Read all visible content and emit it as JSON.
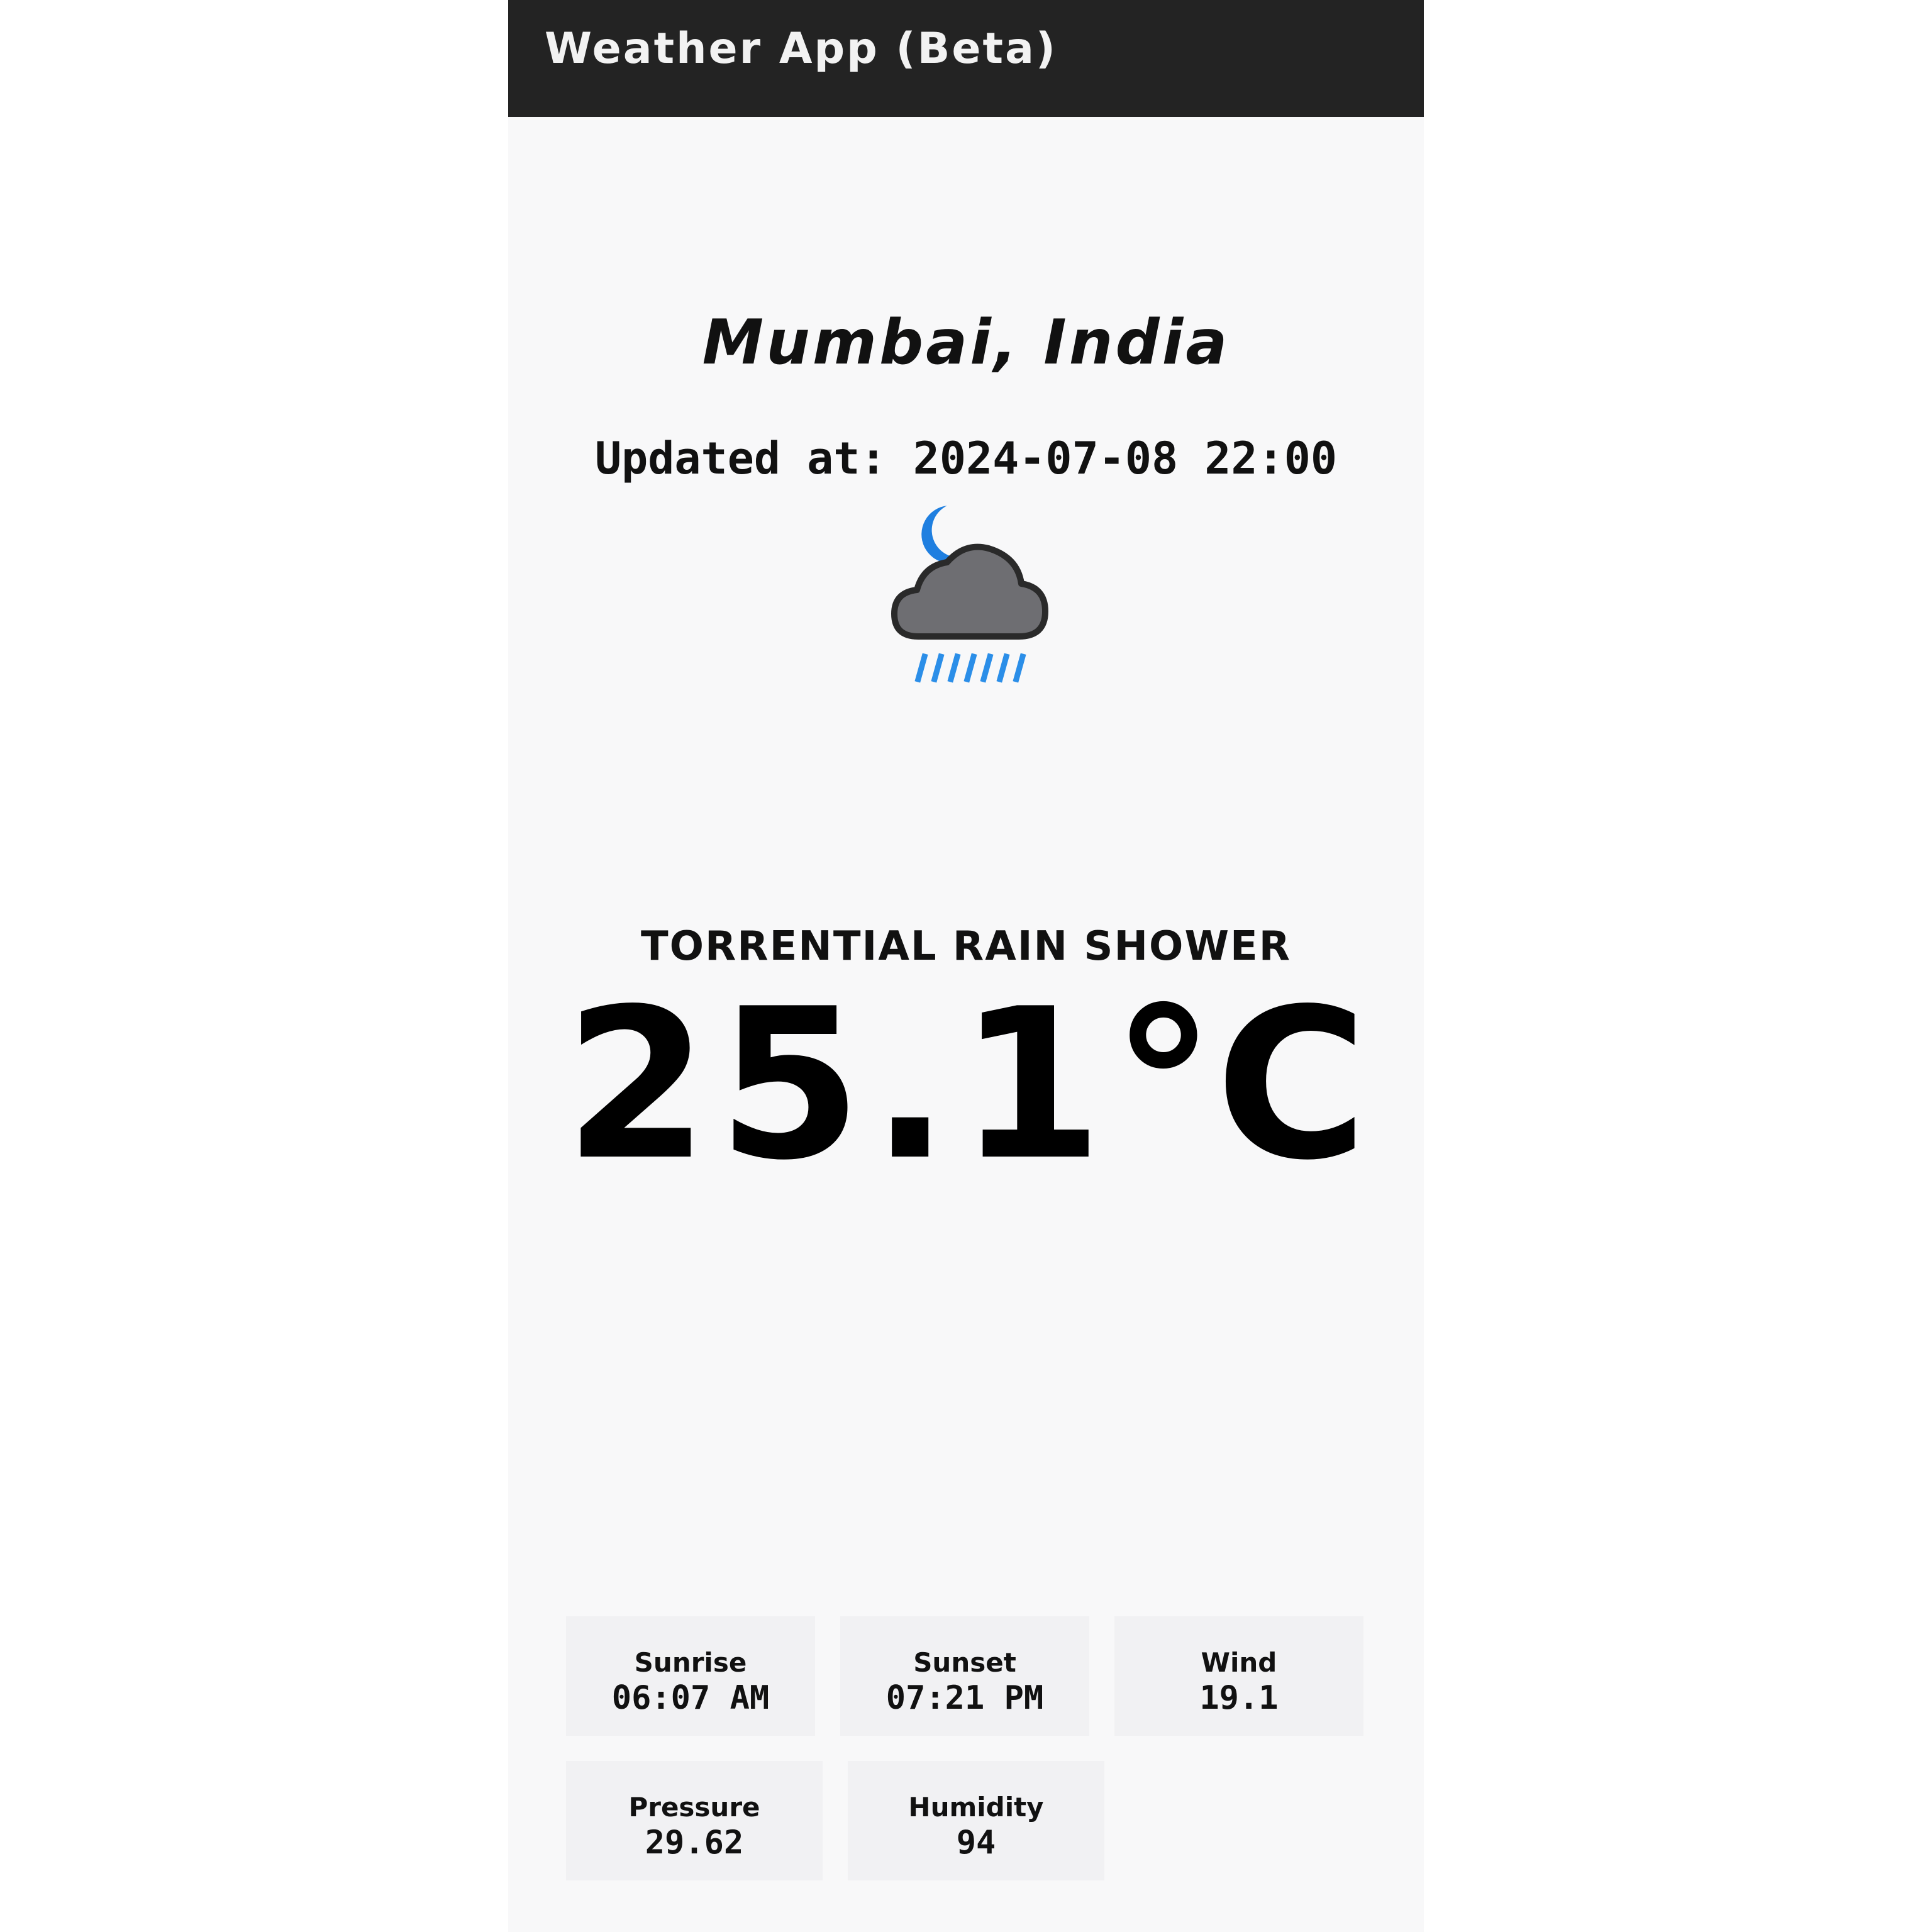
{
  "app": {
    "title": "Weather App (Beta)"
  },
  "location": {
    "name": "Mumbai, India"
  },
  "updated": {
    "text": "Updated at: 2024-07-08 22:00"
  },
  "current": {
    "icon": "night-rain-cloud-icon",
    "condition": "TORRENTIAL RAIN SHOWER",
    "temperature": "25.1",
    "unit": "°C"
  },
  "colors": {
    "app_bar": "#232323",
    "background": "#f8f8f9",
    "card": "#f1f1f3",
    "moon": "#1f7fe0",
    "cloud": "#6e6e72",
    "rain": "#2b8ee8"
  },
  "details": {
    "sunrise": {
      "label": "Sunrise",
      "value": "06:07 AM"
    },
    "sunset": {
      "label": "Sunset",
      "value": "07:21 PM"
    },
    "wind": {
      "label": "Wind",
      "value": "19.1"
    },
    "pressure": {
      "label": "Pressure",
      "value": "29.62"
    },
    "humidity": {
      "label": "Humidity",
      "value": "94"
    }
  }
}
